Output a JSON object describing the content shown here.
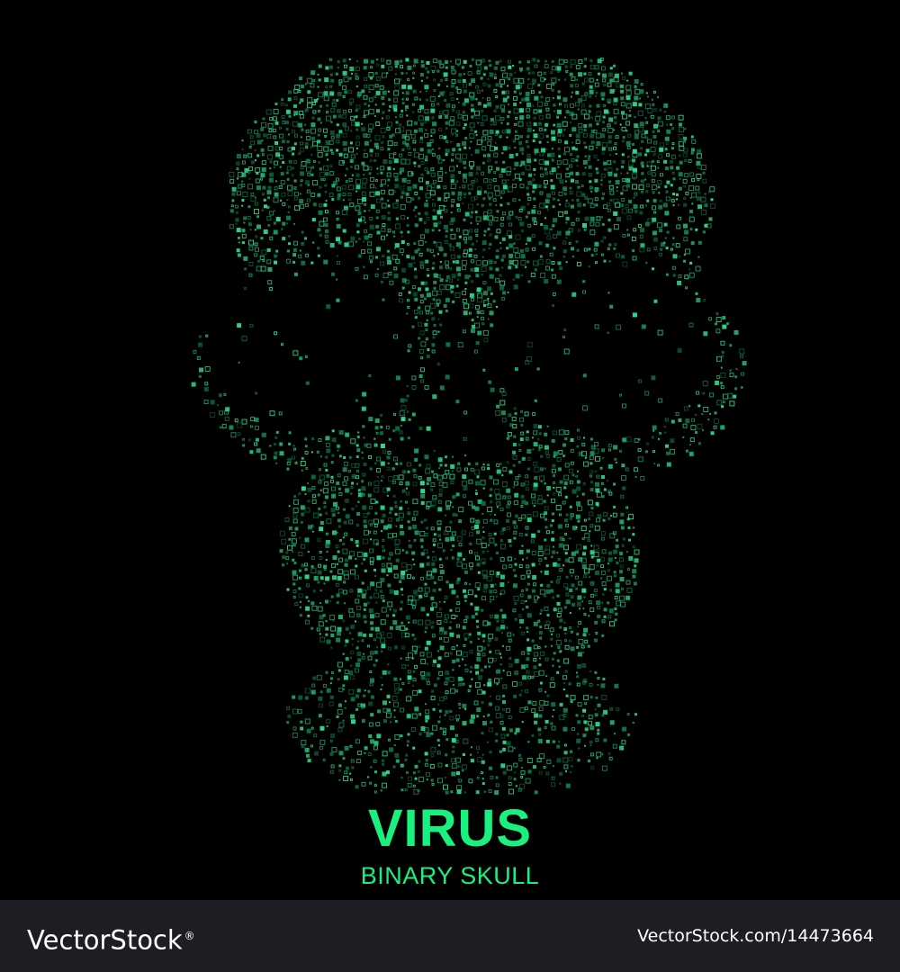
{
  "title": "VIRUS",
  "subtitle": "BINARY SKULL",
  "watermark": {
    "brand": "VectorStock",
    "trademark": "®",
    "url": "VectorStock.com/14473664"
  },
  "colors": {
    "background": "#000000",
    "accent": "#19f07f",
    "skull_bright": "#2bd98a",
    "skull_dim": "#0e7a4c",
    "footer_bg": "#1d1e23"
  }
}
